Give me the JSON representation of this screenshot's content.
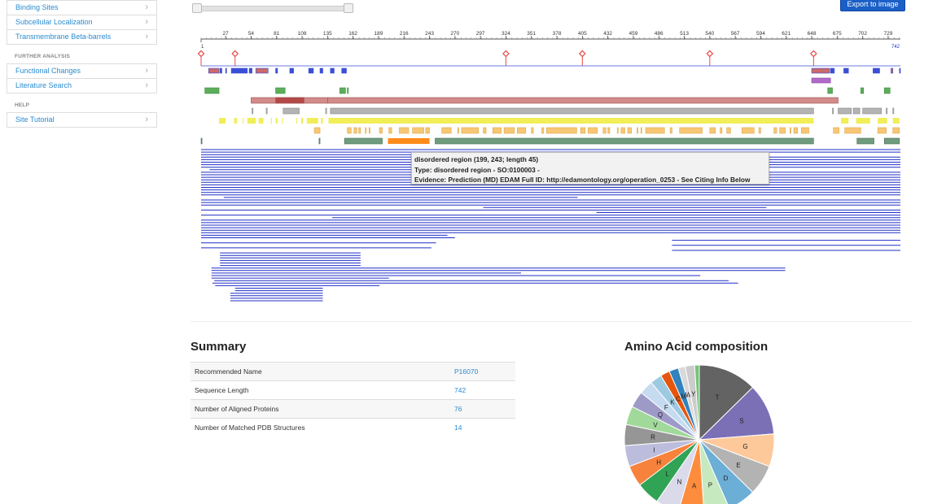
{
  "sidebar": {
    "items_top": [
      {
        "label": "Binding Sites"
      },
      {
        "label": "Subcellular Localization"
      },
      {
        "label": "Transmembrane Beta-barrels"
      }
    ],
    "section_further": "FURTHER ANALYSIS",
    "items_further": [
      {
        "label": "Functional Changes"
      },
      {
        "label": "Literature Search"
      }
    ],
    "section_help": "HELP",
    "items_help": [
      {
        "label": "Site Tutorial"
      }
    ]
  },
  "toolbar": {
    "export_label": "Export to image"
  },
  "viewer": {
    "sequence_length": 742,
    "ruler_start": "1",
    "ruler_end": "742",
    "ticks": [
      27,
      54,
      81,
      108,
      135,
      162,
      189,
      216,
      243,
      270,
      297,
      324,
      351,
      378,
      405,
      432,
      459,
      486,
      513,
      540,
      567,
      594,
      621,
      648,
      675,
      702,
      729
    ],
    "sites": [
      1,
      37,
      324,
      405,
      540,
      650
    ],
    "colors": {
      "site": "#e84a4a",
      "blue": "#3b4fd6",
      "red": "#c96a6a",
      "purple": "#b06ac8",
      "green": "#5cae5c",
      "pink": "#d28a8a",
      "darkred": "#b44848",
      "gray": "#b3b3b3",
      "yellow": "#f1ee57",
      "orange_light": "#f7c775",
      "orange": "#ff8b1a",
      "teal": "#6f9c7e",
      "align": "#1f2fc6"
    }
  },
  "tooltip": {
    "line1": "disordered region (199, 243; length 45)",
    "line2": "Type: disordered region - SO:0100003 -",
    "line3": "Evidence: Prediction (MD) EDAM Full ID: http://edamontology.org/operation_0253 - See Citing Info Below"
  },
  "summary": {
    "title": "Summary",
    "rows": [
      {
        "label": "Recommended Name",
        "value": "P16070"
      },
      {
        "label": "Sequence Length",
        "value": "742"
      },
      {
        "label": "Number of Aligned Proteins",
        "value": "76"
      },
      {
        "label": "Number of Matched PDB Structures",
        "value": "14"
      }
    ]
  },
  "aa_composition": {
    "title": "Amino Acid composition",
    "slices": [
      {
        "label": "T",
        "value": 12.5,
        "color": "#636363"
      },
      {
        "label": "S",
        "value": 11.0,
        "color": "#7b6fb5"
      },
      {
        "label": "G",
        "value": 7.0,
        "color": "#fdc99b"
      },
      {
        "label": "E",
        "value": 6.5,
        "color": "#b3b3b3"
      },
      {
        "label": "D",
        "value": 6.0,
        "color": "#6baed6"
      },
      {
        "label": "P",
        "value": 5.5,
        "color": "#c7e9c0"
      },
      {
        "label": "A",
        "value": 5.5,
        "color": "#fd8d3c"
      },
      {
        "label": "N",
        "value": 5.0,
        "color": "#dadaeb"
      },
      {
        "label": "L",
        "value": 5.0,
        "color": "#31a354"
      },
      {
        "label": "H",
        "value": 4.5,
        "color": "#f7823c"
      },
      {
        "label": "I",
        "value": 4.5,
        "color": "#bcbddc"
      },
      {
        "label": "R",
        "value": 4.5,
        "color": "#969696"
      },
      {
        "label": "V",
        "value": 4.0,
        "color": "#a1d99b"
      },
      {
        "label": "Q",
        "value": 3.5,
        "color": "#9e9ac8"
      },
      {
        "label": "F",
        "value": 3.0,
        "color": "#c6dbef"
      },
      {
        "label": "K",
        "value": 2.5,
        "color": "#9ecae1"
      },
      {
        "label": "C",
        "value": 2.0,
        "color": "#e6550d"
      },
      {
        "label": "M",
        "value": 2.0,
        "color": "#3182bd"
      },
      {
        "label": "W",
        "value": 1.5,
        "color": "#d9d9d9"
      },
      {
        "label": "Y",
        "value": 2.0,
        "color": "#cccccc"
      },
      {
        "label": "",
        "value": 1.0,
        "color": "#74c476"
      }
    ]
  }
}
